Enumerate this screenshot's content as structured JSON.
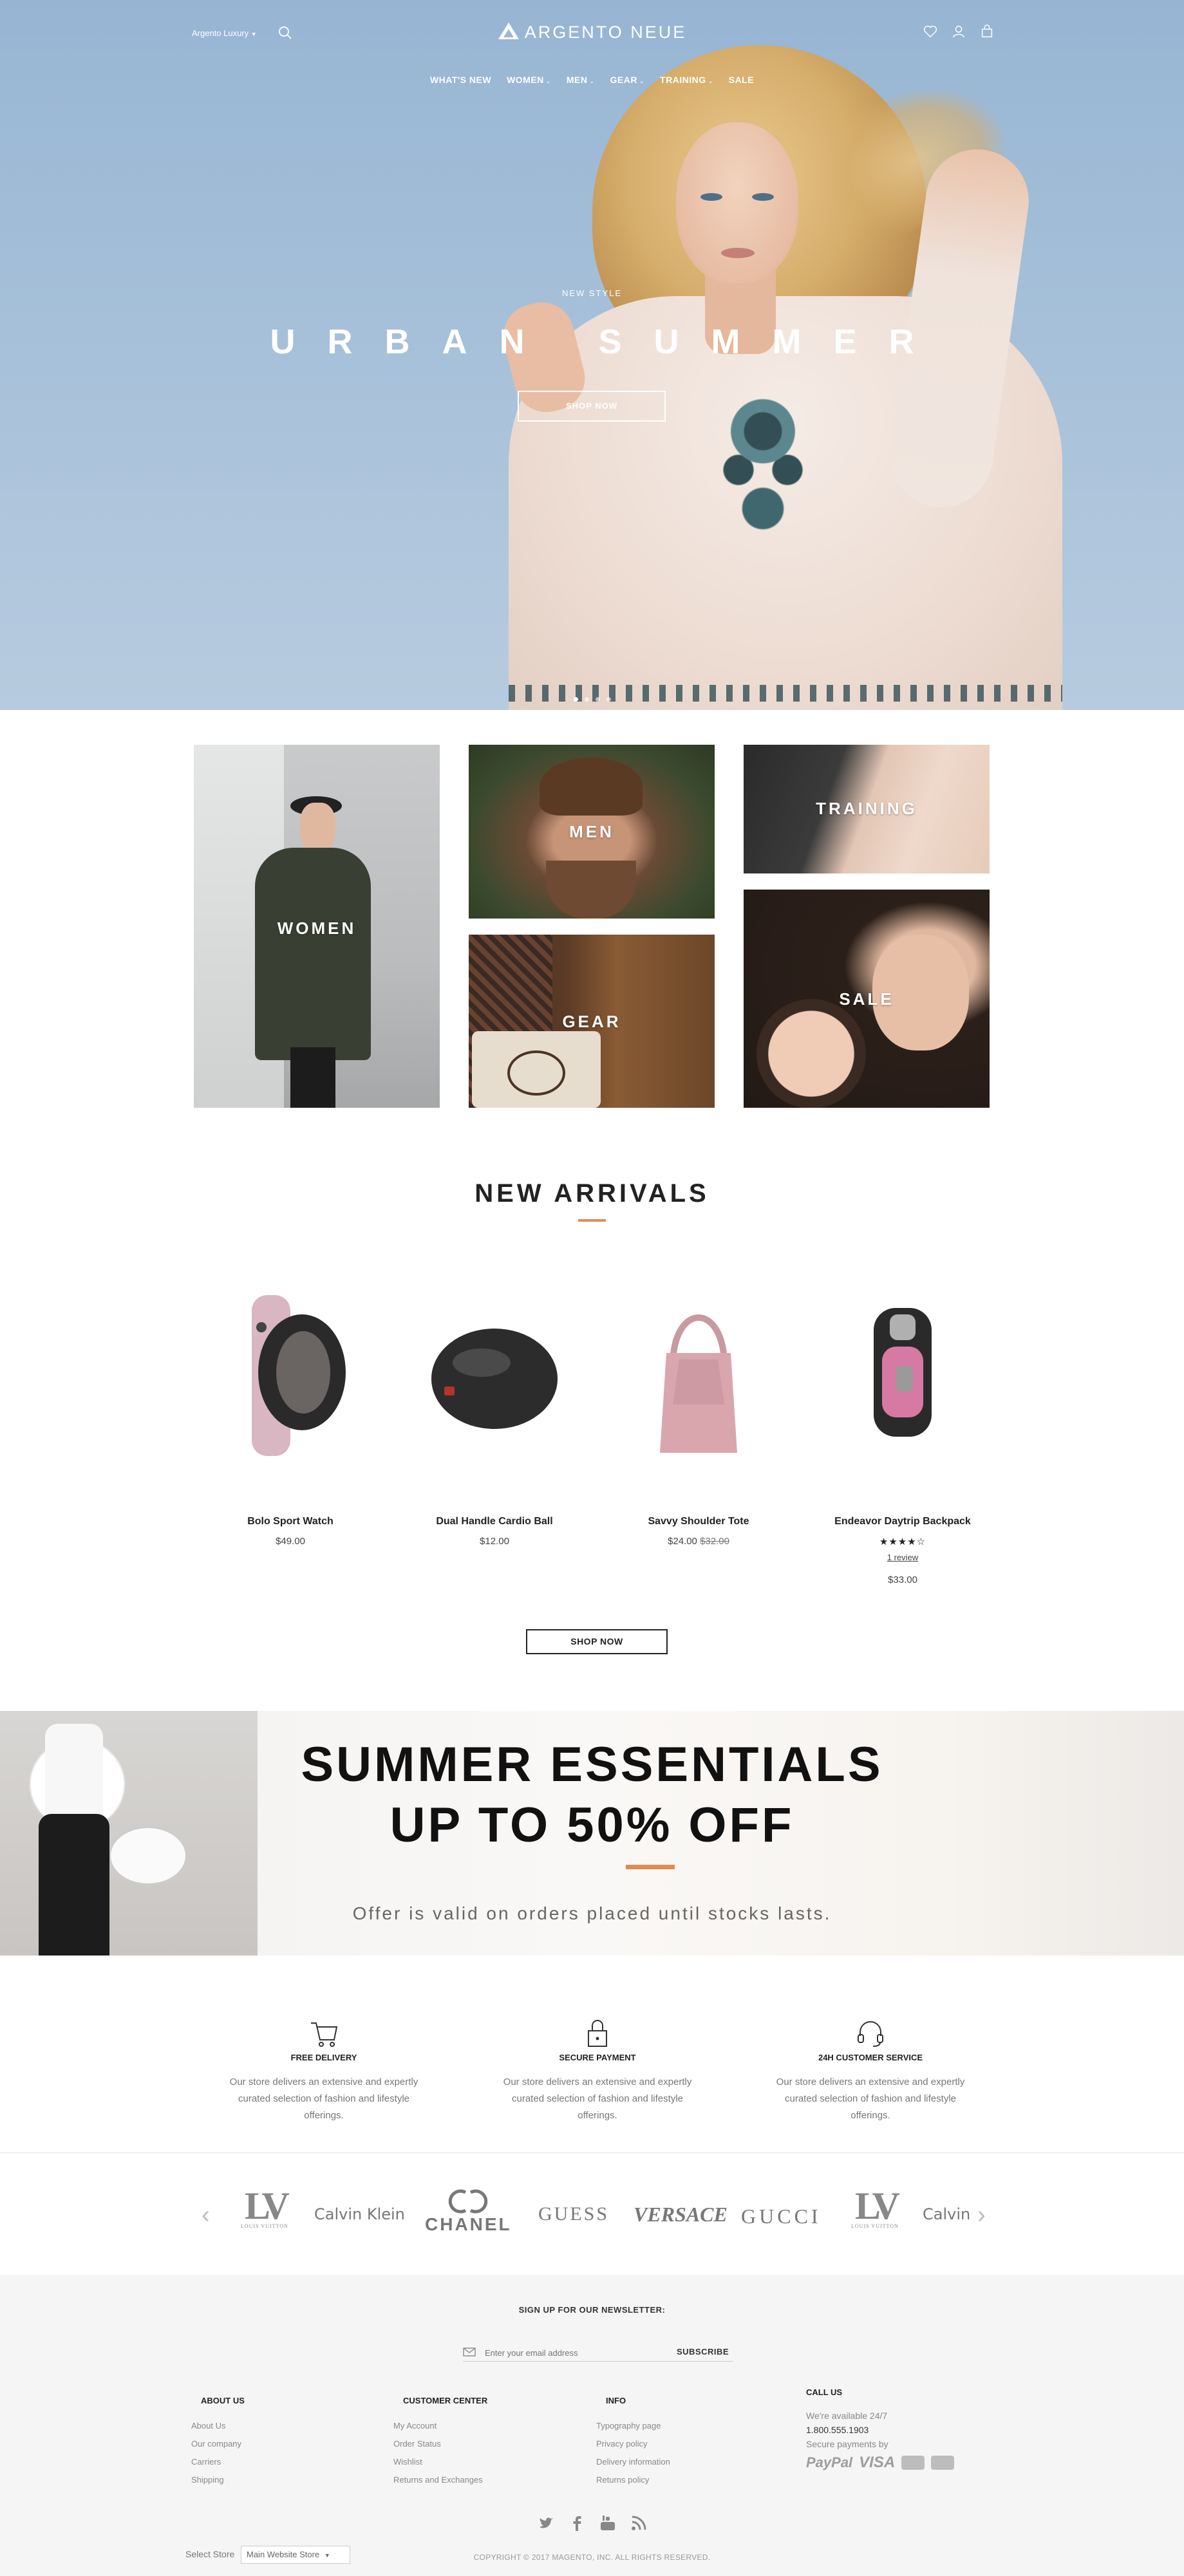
{
  "header": {
    "store_switcher": "Argento Luxury",
    "logo_text": "ARGENTO NEUE"
  },
  "nav": [
    {
      "label": "WHAT'S NEW",
      "has_dropdown": false
    },
    {
      "label": "WOMEN",
      "has_dropdown": true
    },
    {
      "label": "MEN",
      "has_dropdown": true
    },
    {
      "label": "GEAR",
      "has_dropdown": true
    },
    {
      "label": "TRAINING",
      "has_dropdown": true
    },
    {
      "label": "SALE",
      "has_dropdown": false
    }
  ],
  "hero": {
    "kicker": "NEW STYLE",
    "title": "URBAN SUMMER",
    "button": "SHOP NOW",
    "slides_count": 4,
    "active_slide": 1
  },
  "categories": {
    "women": "WOMEN",
    "men": "MEN",
    "gear": "GEAR",
    "training": "TRAINING",
    "sale": "SALE"
  },
  "new_arrivals": {
    "title": "NEW ARRIVALS",
    "products": [
      {
        "name": "Bolo Sport Watch",
        "price": "$49.00"
      },
      {
        "name": "Dual Handle Cardio Ball",
        "price": "$12.00"
      },
      {
        "name": "Savvy Shoulder Tote",
        "price": "$24.00",
        "old_price": "$32.00"
      },
      {
        "name": "Endeavor Daytrip Backpack",
        "rating": "★★★★☆",
        "rating_value": 4,
        "reviews": "1 review",
        "price": "$33.00"
      }
    ],
    "button": "SHOP NOW"
  },
  "promo": {
    "line1": "SUMMER ESSENTIALS",
    "line2": "UP TO 50% OFF",
    "subtitle": "Offer is valid on orders placed until stocks lasts."
  },
  "features": [
    {
      "icon": "cart-icon",
      "title": "FREE DELIVERY",
      "text": "Our store delivers an extensive and expertly curated selection of fashion and lifestyle offerings."
    },
    {
      "icon": "lock-icon",
      "title": "SECURE PAYMENT",
      "text": "Our store delivers an extensive and expertly curated selection of fashion and lifestyle offerings."
    },
    {
      "icon": "headset-icon",
      "title": "24H CUSTOMER SERVICE",
      "text": "Our store delivers an extensive and expertly curated selection of fashion and lifestyle offerings."
    }
  ],
  "brands": {
    "lv_mark": "LV",
    "lv_caption": "LOUIS VUITTON",
    "calvin": "Calvin Klein",
    "calvin_cut": "Calvin K",
    "chanel": "CHANEL",
    "guess": "GUESS",
    "versace": "VERSACE",
    "gucci": "GUCCI",
    "prev": "‹",
    "next": "›"
  },
  "footer": {
    "newsletter_title": "SIGN UP FOR OUR NEWSLETTER:",
    "newsletter_placeholder": "Enter your email address",
    "subscribe": "SUBSCRIBE",
    "about": {
      "title": "ABOUT US",
      "links": [
        "About Us",
        "Our company",
        "Carriers",
        "Shipping"
      ]
    },
    "customer": {
      "title": "CUSTOMER CENTER",
      "links": [
        "My Account",
        "Order Status",
        "Wishlist",
        "Returns and Exchanges"
      ]
    },
    "info": {
      "title": "INFO",
      "links": [
        "Typography page",
        "Privacy policy",
        "Delivery information",
        "Returns policy"
      ]
    },
    "call": {
      "title": "CALL US",
      "availability": "We're available 24/7",
      "phone": "1.800.555.1903",
      "secure": "Secure payments by",
      "paypal": "PayPal",
      "visa": "VISA"
    },
    "select_store_label": "Select Store",
    "select_store_value": "Main Website Store",
    "copyright": "COPYRIGHT © 2017 MAGENTO, INC. ALL RIGHTS RESERVED."
  }
}
